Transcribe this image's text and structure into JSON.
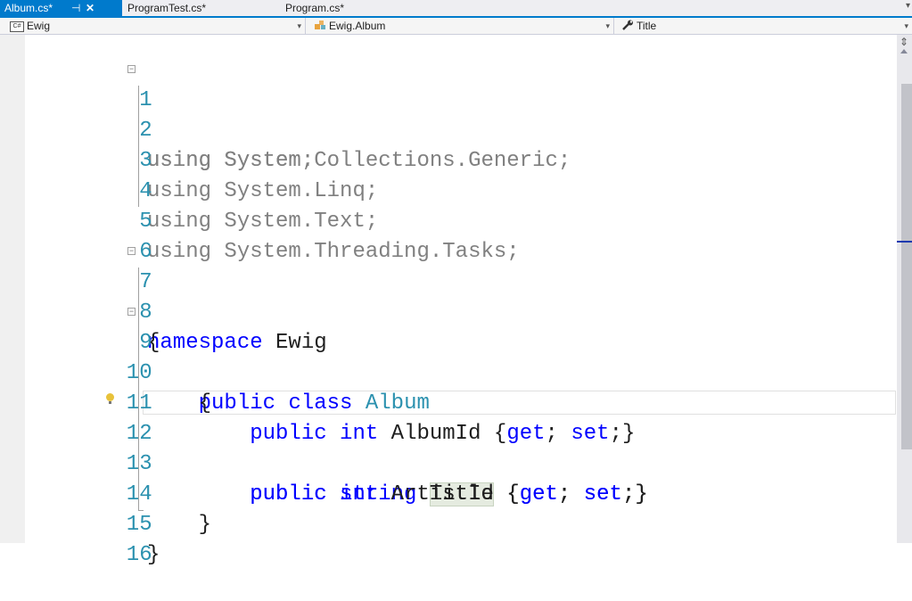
{
  "tabs": [
    {
      "label": "Album.cs*",
      "active": true
    },
    {
      "label": "ProgramTest.cs*",
      "active": false
    },
    {
      "label": "Program.cs*",
      "active": false
    }
  ],
  "nav": {
    "project": "Ewig",
    "type": "Ewig.Album",
    "member": "Title"
  },
  "editor": {
    "current_line": 12,
    "highlighted_word": "Title",
    "lines": [
      {
        "n": "1"
      },
      {
        "n": "2"
      },
      {
        "n": "3"
      },
      {
        "n": "4"
      },
      {
        "n": "5"
      },
      {
        "n": "6"
      },
      {
        "n": "7"
      },
      {
        "n": "8"
      },
      {
        "n": "9"
      },
      {
        "n": "10"
      },
      {
        "n": "11"
      },
      {
        "n": "12"
      },
      {
        "n": "13"
      },
      {
        "n": "14"
      },
      {
        "n": "15"
      },
      {
        "n": "16"
      }
    ],
    "code": {
      "kw_using": "using",
      "ns_system": "System;",
      "ns_generic": "System.Collections.Generic;",
      "ns_linq": "System.Linq;",
      "ns_text": "System.Text;",
      "ns_tasks": "System.Threading.Tasks;",
      "kw_namespace": "namespace",
      "ns_name": "Ewig",
      "open_brace": "{",
      "close_brace": "}",
      "kw_public": "public",
      "kw_class": "class",
      "class_name": "Album",
      "kw_int": "int",
      "kw_string": "string",
      "prop_albumid": "AlbumId",
      "prop_title": "Title",
      "prop_artistid": "ArtistId",
      "kw_get": "get",
      "kw_set": "set",
      "acc_open": "{",
      "acc_sep": "; ",
      "acc_close": ";}"
    }
  },
  "colors": {
    "accent": "#007acc",
    "keyword": "#0000ff",
    "line_number": "#2b91af",
    "type_name": "#2b91af",
    "unused_using": "#808080"
  },
  "icons": {
    "tab_pin": "pin-icon",
    "tab_close": "close-icon",
    "project": "csharp-project-icon",
    "type": "class-icon",
    "member": "wrench-property-icon",
    "lightbulb": "lightbulb-icon"
  }
}
